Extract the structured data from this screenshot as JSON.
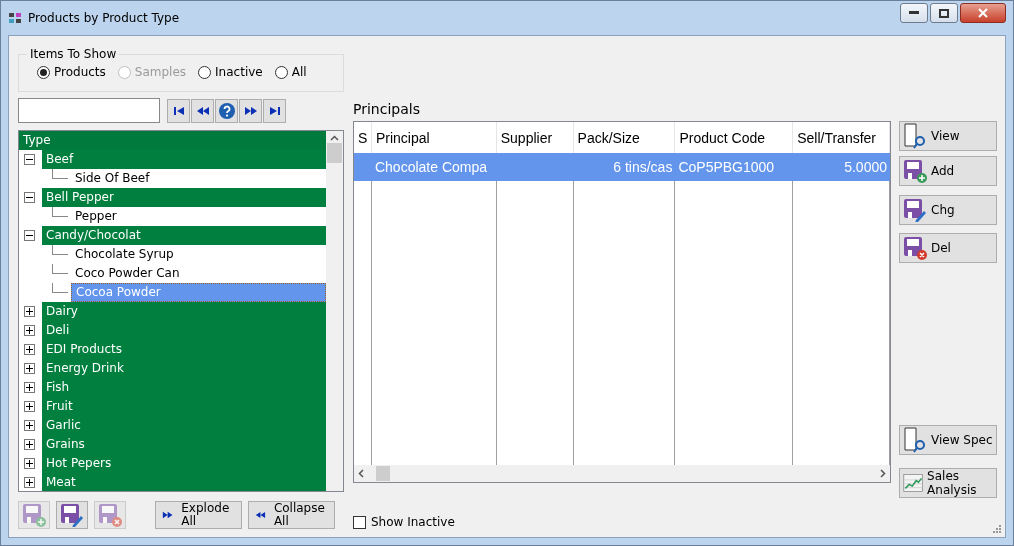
{
  "window": {
    "title": "Products by Product Type"
  },
  "items_to_show": {
    "label": "Items To Show",
    "options": [
      {
        "label": "Products",
        "selected": true,
        "disabled": false
      },
      {
        "label": "Samples",
        "selected": false,
        "disabled": true
      },
      {
        "label": "Inactive",
        "selected": false,
        "disabled": false
      },
      {
        "label": "All",
        "selected": false,
        "disabled": false
      }
    ]
  },
  "tree": {
    "header": "Type",
    "items": [
      {
        "label": "Beef",
        "expanded": true,
        "selected": false,
        "children": [
          {
            "label": "Side Of Beef",
            "selected": false
          }
        ]
      },
      {
        "label": "Bell Pepper",
        "expanded": true,
        "selected": false,
        "children": [
          {
            "label": "Pepper",
            "selected": false
          }
        ]
      },
      {
        "label": "Candy/Chocolat",
        "expanded": true,
        "selected": false,
        "children": [
          {
            "label": "Chocolate Syrup",
            "selected": false
          },
          {
            "label": "Coco Powder Can",
            "selected": false
          },
          {
            "label": "Cocoa Powder",
            "selected": true
          }
        ]
      },
      {
        "label": "Dairy",
        "expanded": false,
        "selected": false
      },
      {
        "label": "Deli",
        "expanded": false,
        "selected": false
      },
      {
        "label": "EDI Products",
        "expanded": false,
        "selected": false
      },
      {
        "label": "Energy Drink",
        "expanded": false,
        "selected": false
      },
      {
        "label": "Fish",
        "expanded": false,
        "selected": false
      },
      {
        "label": "Fruit",
        "expanded": false,
        "selected": false
      },
      {
        "label": "Garlic",
        "expanded": false,
        "selected": false
      },
      {
        "label": "Grains",
        "expanded": false,
        "selected": false
      },
      {
        "label": "Hot Pepers",
        "expanded": false,
        "selected": false
      },
      {
        "label": "Meat",
        "expanded": false,
        "selected": false
      }
    ]
  },
  "tree_buttons": [
    {
      "kind": "add",
      "disabled": true
    },
    {
      "kind": "edit",
      "disabled": false
    },
    {
      "kind": "delete",
      "disabled": true
    }
  ],
  "explode_button": "Explode All",
  "collapse_button": "Collapse All",
  "show_inactive": {
    "label": "Show Inactive",
    "checked": false
  },
  "principals": {
    "title": "Principals",
    "columns": [
      "S",
      "Principal",
      "Supplier",
      "Pack/Size",
      "Product Code",
      "Sell/Transfer"
    ],
    "rows": [
      {
        "selected": true,
        "cells": [
          "",
          "Chocolate Compa",
          "",
          "6 tins/cas",
          "CoP5PBG1000",
          "5.0000"
        ]
      }
    ]
  },
  "side_buttons": [
    {
      "kind": "view",
      "label": "View"
    },
    {
      "kind": "add",
      "label": "Add"
    },
    {
      "kind": "edit",
      "label": "Chg"
    },
    {
      "kind": "delete",
      "label": "Del"
    }
  ],
  "bottom_side_buttons": [
    {
      "kind": "view",
      "label": "View Spec"
    },
    {
      "kind": "chart",
      "label": "Sales Analysis"
    }
  ]
}
